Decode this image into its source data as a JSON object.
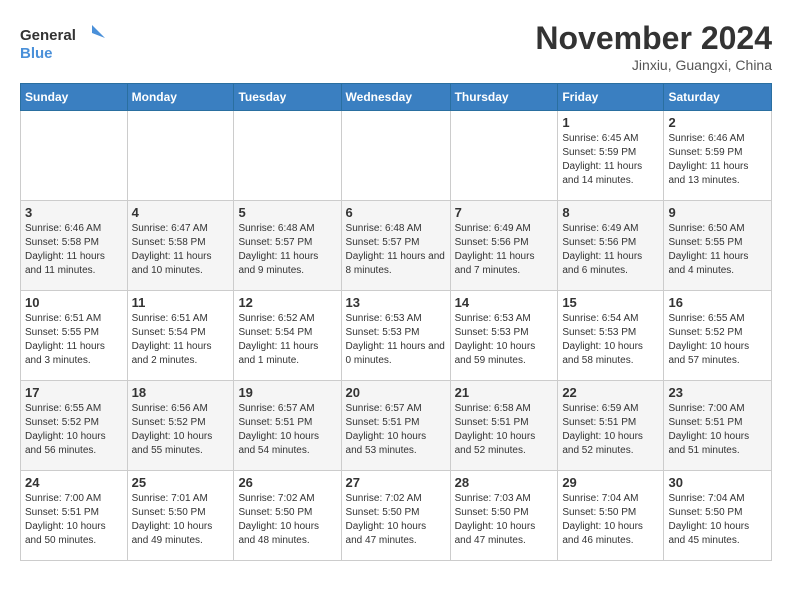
{
  "logo": {
    "line1": "General",
    "line2": "Blue"
  },
  "title": "November 2024",
  "location": "Jinxiu, Guangxi, China",
  "weekdays": [
    "Sunday",
    "Monday",
    "Tuesday",
    "Wednesday",
    "Thursday",
    "Friday",
    "Saturday"
  ],
  "weeks": [
    [
      {
        "day": "",
        "sunrise": "",
        "sunset": "",
        "daylight": ""
      },
      {
        "day": "",
        "sunrise": "",
        "sunset": "",
        "daylight": ""
      },
      {
        "day": "",
        "sunrise": "",
        "sunset": "",
        "daylight": ""
      },
      {
        "day": "",
        "sunrise": "",
        "sunset": "",
        "daylight": ""
      },
      {
        "day": "",
        "sunrise": "",
        "sunset": "",
        "daylight": ""
      },
      {
        "day": "1",
        "sunrise": "Sunrise: 6:45 AM",
        "sunset": "Sunset: 5:59 PM",
        "daylight": "Daylight: 11 hours and 14 minutes."
      },
      {
        "day": "2",
        "sunrise": "Sunrise: 6:46 AM",
        "sunset": "Sunset: 5:59 PM",
        "daylight": "Daylight: 11 hours and 13 minutes."
      }
    ],
    [
      {
        "day": "3",
        "sunrise": "Sunrise: 6:46 AM",
        "sunset": "Sunset: 5:58 PM",
        "daylight": "Daylight: 11 hours and 11 minutes."
      },
      {
        "day": "4",
        "sunrise": "Sunrise: 6:47 AM",
        "sunset": "Sunset: 5:58 PM",
        "daylight": "Daylight: 11 hours and 10 minutes."
      },
      {
        "day": "5",
        "sunrise": "Sunrise: 6:48 AM",
        "sunset": "Sunset: 5:57 PM",
        "daylight": "Daylight: 11 hours and 9 minutes."
      },
      {
        "day": "6",
        "sunrise": "Sunrise: 6:48 AM",
        "sunset": "Sunset: 5:57 PM",
        "daylight": "Daylight: 11 hours and 8 minutes."
      },
      {
        "day": "7",
        "sunrise": "Sunrise: 6:49 AM",
        "sunset": "Sunset: 5:56 PM",
        "daylight": "Daylight: 11 hours and 7 minutes."
      },
      {
        "day": "8",
        "sunrise": "Sunrise: 6:49 AM",
        "sunset": "Sunset: 5:56 PM",
        "daylight": "Daylight: 11 hours and 6 minutes."
      },
      {
        "day": "9",
        "sunrise": "Sunrise: 6:50 AM",
        "sunset": "Sunset: 5:55 PM",
        "daylight": "Daylight: 11 hours and 4 minutes."
      }
    ],
    [
      {
        "day": "10",
        "sunrise": "Sunrise: 6:51 AM",
        "sunset": "Sunset: 5:55 PM",
        "daylight": "Daylight: 11 hours and 3 minutes."
      },
      {
        "day": "11",
        "sunrise": "Sunrise: 6:51 AM",
        "sunset": "Sunset: 5:54 PM",
        "daylight": "Daylight: 11 hours and 2 minutes."
      },
      {
        "day": "12",
        "sunrise": "Sunrise: 6:52 AM",
        "sunset": "Sunset: 5:54 PM",
        "daylight": "Daylight: 11 hours and 1 minute."
      },
      {
        "day": "13",
        "sunrise": "Sunrise: 6:53 AM",
        "sunset": "Sunset: 5:53 PM",
        "daylight": "Daylight: 11 hours and 0 minutes."
      },
      {
        "day": "14",
        "sunrise": "Sunrise: 6:53 AM",
        "sunset": "Sunset: 5:53 PM",
        "daylight": "Daylight: 10 hours and 59 minutes."
      },
      {
        "day": "15",
        "sunrise": "Sunrise: 6:54 AM",
        "sunset": "Sunset: 5:53 PM",
        "daylight": "Daylight: 10 hours and 58 minutes."
      },
      {
        "day": "16",
        "sunrise": "Sunrise: 6:55 AM",
        "sunset": "Sunset: 5:52 PM",
        "daylight": "Daylight: 10 hours and 57 minutes."
      }
    ],
    [
      {
        "day": "17",
        "sunrise": "Sunrise: 6:55 AM",
        "sunset": "Sunset: 5:52 PM",
        "daylight": "Daylight: 10 hours and 56 minutes."
      },
      {
        "day": "18",
        "sunrise": "Sunrise: 6:56 AM",
        "sunset": "Sunset: 5:52 PM",
        "daylight": "Daylight: 10 hours and 55 minutes."
      },
      {
        "day": "19",
        "sunrise": "Sunrise: 6:57 AM",
        "sunset": "Sunset: 5:51 PM",
        "daylight": "Daylight: 10 hours and 54 minutes."
      },
      {
        "day": "20",
        "sunrise": "Sunrise: 6:57 AM",
        "sunset": "Sunset: 5:51 PM",
        "daylight": "Daylight: 10 hours and 53 minutes."
      },
      {
        "day": "21",
        "sunrise": "Sunrise: 6:58 AM",
        "sunset": "Sunset: 5:51 PM",
        "daylight": "Daylight: 10 hours and 52 minutes."
      },
      {
        "day": "22",
        "sunrise": "Sunrise: 6:59 AM",
        "sunset": "Sunset: 5:51 PM",
        "daylight": "Daylight: 10 hours and 52 minutes."
      },
      {
        "day": "23",
        "sunrise": "Sunrise: 7:00 AM",
        "sunset": "Sunset: 5:51 PM",
        "daylight": "Daylight: 10 hours and 51 minutes."
      }
    ],
    [
      {
        "day": "24",
        "sunrise": "Sunrise: 7:00 AM",
        "sunset": "Sunset: 5:51 PM",
        "daylight": "Daylight: 10 hours and 50 minutes."
      },
      {
        "day": "25",
        "sunrise": "Sunrise: 7:01 AM",
        "sunset": "Sunset: 5:50 PM",
        "daylight": "Daylight: 10 hours and 49 minutes."
      },
      {
        "day": "26",
        "sunrise": "Sunrise: 7:02 AM",
        "sunset": "Sunset: 5:50 PM",
        "daylight": "Daylight: 10 hours and 48 minutes."
      },
      {
        "day": "27",
        "sunrise": "Sunrise: 7:02 AM",
        "sunset": "Sunset: 5:50 PM",
        "daylight": "Daylight: 10 hours and 47 minutes."
      },
      {
        "day": "28",
        "sunrise": "Sunrise: 7:03 AM",
        "sunset": "Sunset: 5:50 PM",
        "daylight": "Daylight: 10 hours and 47 minutes."
      },
      {
        "day": "29",
        "sunrise": "Sunrise: 7:04 AM",
        "sunset": "Sunset: 5:50 PM",
        "daylight": "Daylight: 10 hours and 46 minutes."
      },
      {
        "day": "30",
        "sunrise": "Sunrise: 7:04 AM",
        "sunset": "Sunset: 5:50 PM",
        "daylight": "Daylight: 10 hours and 45 minutes."
      }
    ]
  ]
}
